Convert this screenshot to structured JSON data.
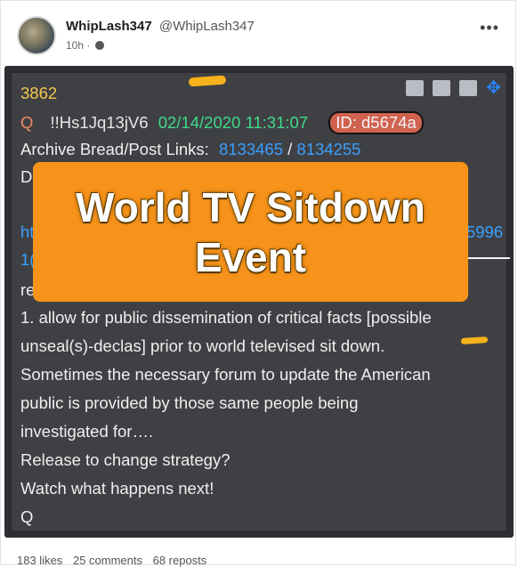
{
  "author": {
    "name": "WhipLash347",
    "handle": "@WhipLash347",
    "time": "10h",
    "visibility_icon": "globe-icon"
  },
  "menu_label": "•••",
  "post": {
    "number": "3862",
    "q": "Q",
    "tripcode": "!!Hs1Jq13jV6",
    "date": "02/14/2020 11:31:07",
    "id": "ID: d5674a",
    "archive_label": "Archive Bread/Post Links:",
    "archive_link_1": "8133465",
    "archive_sep": "/",
    "archive_link_2": "8134255",
    "partial_d": "D",
    "partial_link_left_1": "ht",
    "partial_link_left_2": "1(",
    "partial_link_right": "5996",
    "partial_re": "re",
    "body_lines": [
      "1. allow for public dissemination of critical facts [possible",
      "unseal(s)-declas] prior to world televised sit down.",
      "Sometimes the necessary forum to update the American",
      "public is provided by those same people being",
      "investigated for….",
      "Release to change strategy?",
      "Watch what happens next!",
      "Q"
    ]
  },
  "overlay": {
    "line1": "World TV Sitdown",
    "line2": "Event"
  },
  "stats": {
    "likes": "183 likes",
    "comments": "25 comments",
    "reposts": "68 reposts"
  },
  "colors": {
    "overlay": "#f7931a",
    "background": "#3f4044",
    "link": "#3aa0ff",
    "date": "#3fd98a",
    "number": "#f2c94c"
  }
}
